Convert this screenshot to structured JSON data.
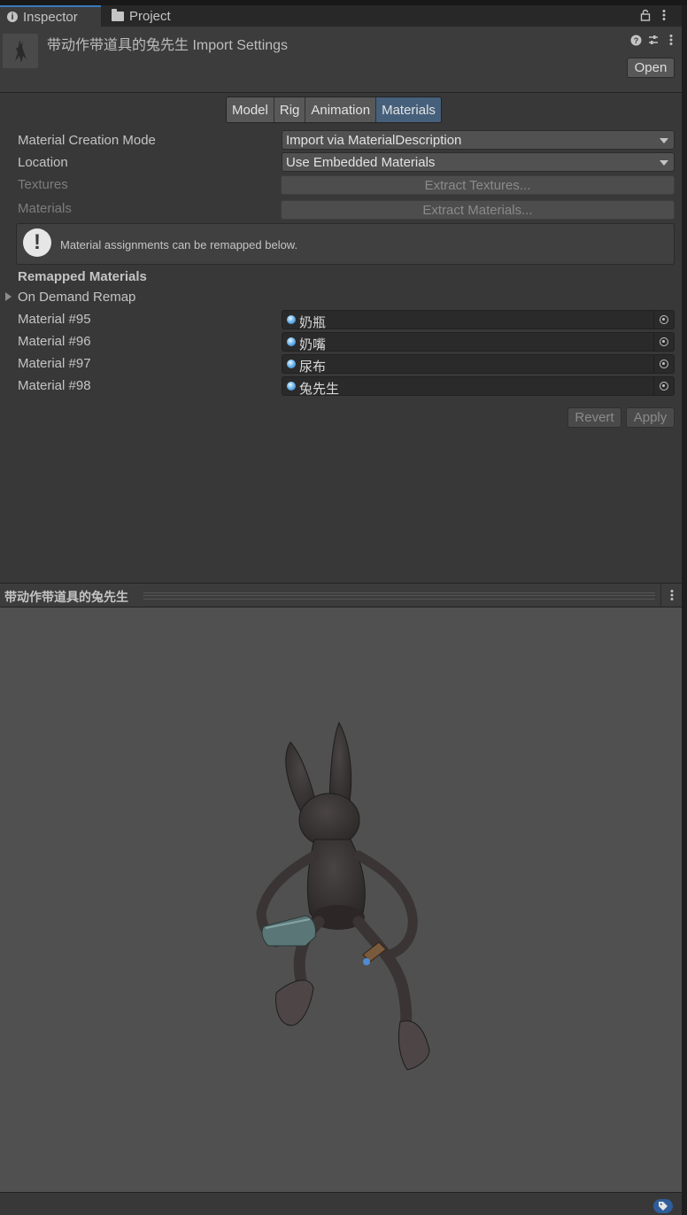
{
  "tabs": [
    {
      "label": "Inspector",
      "icon": "info-icon",
      "active": true
    },
    {
      "label": "Project",
      "icon": "folder-icon",
      "active": false
    }
  ],
  "header": {
    "title": "带动作带道具的兔先生 Import Settings",
    "open_label": "Open",
    "icons": [
      "lock-icon",
      "more-vert-icon",
      "help-icon",
      "preset-sliders-icon",
      "more-vert-icon"
    ]
  },
  "toolbar_tabs": [
    {
      "label": "Model",
      "active": false
    },
    {
      "label": "Rig",
      "active": false
    },
    {
      "label": "Animation",
      "active": false
    },
    {
      "label": "Materials",
      "active": true
    }
  ],
  "fields": {
    "material_creation_mode": {
      "label": "Material Creation Mode",
      "value": "Import via MaterialDescription"
    },
    "location": {
      "label": "Location",
      "value": "Use Embedded Materials"
    },
    "textures": {
      "label": "Textures",
      "button": "Extract Textures..."
    },
    "materials": {
      "label": "Materials",
      "button": "Extract Materials..."
    }
  },
  "helpbox": {
    "icon": "warning-icon",
    "text": "Material assignments can be remapped below."
  },
  "remapped": {
    "heading": "Remapped Materials",
    "foldout": "On Demand Remap",
    "rows": [
      {
        "label": "Material #95",
        "value": "奶瓶"
      },
      {
        "label": "Material #96",
        "value": "奶嘴"
      },
      {
        "label": "Material #97",
        "value": "尿布"
      },
      {
        "label": "Material #98",
        "value": "兔先生"
      }
    ]
  },
  "actions": {
    "revert": "Revert",
    "apply": "Apply"
  },
  "preview": {
    "title": "带动作带道具的兔先生",
    "menu_icon": "more-vert-icon"
  },
  "colors": {
    "accent": "#3a79bb",
    "active_tab": "#46607c",
    "background": "#383838",
    "viewport": "#505050"
  }
}
